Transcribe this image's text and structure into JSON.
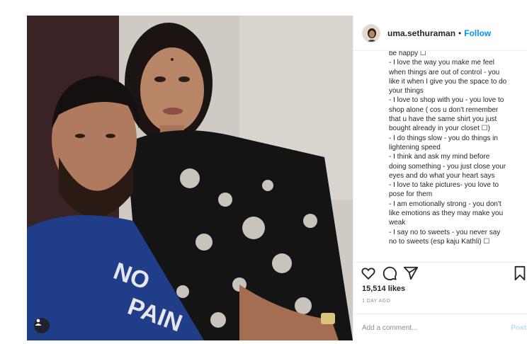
{
  "post": {
    "photo_alt_icon": "user-tag-icon"
  },
  "header": {
    "username": "uma.sethuraman",
    "separator": "•",
    "follow_label": "Follow"
  },
  "caption": {
    "lines": [
      "be happy ☐",
      "- I love the way you make me feel",
      "when things are out of control - you",
      "like it when I give you the space to do",
      "your things",
      "- I love to shop with you - you love to",
      "shop alone ( cos u don't remember",
      "that u have the same shirt you just",
      "bought already in your closet ☐)",
      "- I do things slow - you do things in",
      "lightening speed",
      "- I think and ask my mind before",
      "doing something - you just close your",
      "eyes and do what your heart says",
      "- I love to take pictures- you love to",
      "pose for them",
      "- I am emotionally strong - you don't",
      "like emotions as they may make you",
      "weak",
      "- I say no to sweets - you never say",
      "no to sweets (esp kaju Kathli) ☐"
    ]
  },
  "actions": {
    "icons": [
      "heart-icon",
      "comment-icon",
      "share-icon",
      "bookmark-icon"
    ],
    "likes": "15,514 likes",
    "date": "1 DAY AGO",
    "comment_placeholder": "Add a comment...",
    "post_label": "Post"
  },
  "colors": {
    "link_blue": "#0095f6",
    "post_disabled": "#b2dffc",
    "muted": "#8e8e8e",
    "border": "#efefef"
  }
}
